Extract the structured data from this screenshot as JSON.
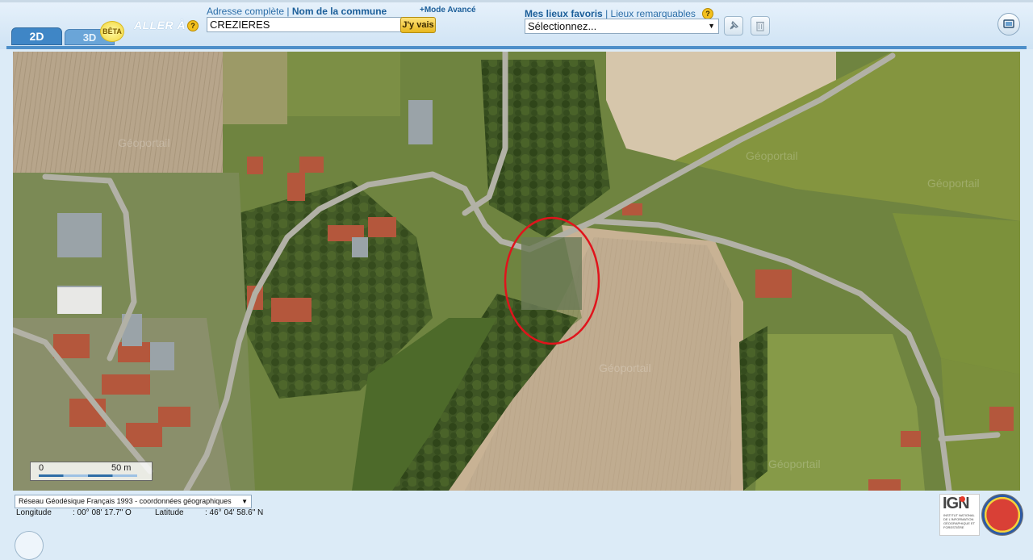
{
  "tabs": {
    "tab_2d": "2D",
    "tab_3d": "3D",
    "beta": "BÊTA"
  },
  "goto": {
    "label": "ALLER À",
    "help": "?",
    "link_full_address": "Adresse complète",
    "separator": "|",
    "link_commune": "Nom de la commune",
    "advanced_mode": "+Mode Avancé",
    "search_value": "CREZIERES",
    "go_button": "J'y vais"
  },
  "favorites": {
    "link_favorites": "Mes lieux favoris",
    "separator": "|",
    "link_remarkable": "Lieux remarquables",
    "help": "?",
    "select_value": "Sélectionnez...",
    "arrow": "▼"
  },
  "icons": {
    "pin": "pin-icon",
    "trash": "trash-icon",
    "screen": "screen-icon"
  },
  "map": {
    "watermark": "Géoportail",
    "highlight_color": "#e0141c"
  },
  "scale": {
    "zero": "0",
    "distance": "50 m"
  },
  "footer": {
    "projection": "Réseau Géodésique Français 1993 - coordonnées géographiques",
    "longitude_label": "Longitude",
    "longitude_value": ": 00° 08' 17.7\" O",
    "latitude_label": "Latitude",
    "latitude_value": ": 46° 04' 58.6\" N",
    "ign_logo": "IGN",
    "ign_subtitle": "INSTITUT NATIONAL DE L'INFORMATION GÉOGRAPHIQUE ET FORESTIÈRE"
  },
  "colors": {
    "accent": "#3f86c6",
    "link": "#2c6ea8",
    "header_bg": "#dcebf7"
  }
}
